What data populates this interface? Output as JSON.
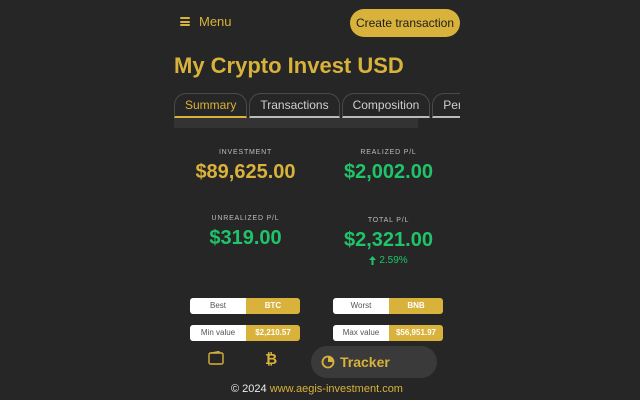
{
  "header": {
    "menu_label": "Menu",
    "create_label": "Create transaction"
  },
  "page": {
    "title": "My Crypto Invest USD"
  },
  "tabs": [
    {
      "label": "Summary",
      "active": true
    },
    {
      "label": "Transactions",
      "active": false
    },
    {
      "label": "Composition",
      "active": false
    },
    {
      "label": "Performance",
      "active": false
    }
  ],
  "stats": {
    "investment": {
      "label": "INVESTMENT",
      "value": "$89,625.00"
    },
    "realized": {
      "label": "REALIZED P/L",
      "value": "$2,002.00"
    },
    "unrealized": {
      "label": "UNREALIZED P/L",
      "value": "$319.00"
    },
    "total": {
      "label": "TOTAL P/L",
      "value": "$2,321.00",
      "change": "2.59%"
    }
  },
  "pills": {
    "best": {
      "label": "Best",
      "value": "BTC"
    },
    "worst": {
      "label": "Worst",
      "value": "BNB"
    },
    "min": {
      "label": "Min value",
      "value": "$2,210.57"
    },
    "max": {
      "label": "Max value",
      "value": "$56,951.97"
    }
  },
  "bottom_nav": {
    "tracker_label": "Tracker",
    "icons": [
      "wallet-icon",
      "bitcoin-icon",
      "pie-chart-icon"
    ]
  },
  "footer": {
    "copyright": "© 2024",
    "link_text": "www.aegis-investment.com"
  },
  "colors": {
    "accent": "#d8b23a",
    "positive": "#1fc46a",
    "background": "#262626"
  }
}
